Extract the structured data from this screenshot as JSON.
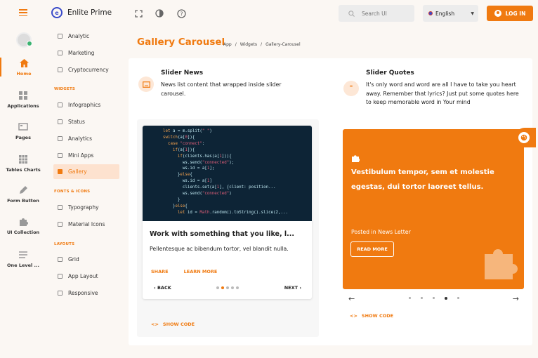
{
  "brand": {
    "name": "Enlite Prime"
  },
  "topbar": {
    "search_placeholder": "Search UI",
    "language": "English",
    "login_label": "LOG IN"
  },
  "rail": {
    "items": [
      {
        "label": "Home",
        "icon": "home-icon",
        "active": true
      },
      {
        "label": "Applications",
        "icon": "apps-icon"
      },
      {
        "label": "Pages",
        "icon": "pages-icon"
      },
      {
        "label": "Tables Charts",
        "icon": "table-icon"
      },
      {
        "label": "Form Button",
        "icon": "pen-icon"
      },
      {
        "label": "UI Collection",
        "icon": "puzzle-icon"
      },
      {
        "label": "One Level ...",
        "icon": "list-icon"
      }
    ]
  },
  "subnav": {
    "top_items": [
      "Analytic",
      "Marketing",
      "Cryptocurrency"
    ],
    "widgets_head": "WIDGETS",
    "widgets_items": [
      "Infographics",
      "Status",
      "Analytics",
      "Mini Apps",
      "Gallery"
    ],
    "fonts_head": "FONTS & ICONS",
    "fonts_items": [
      "Typography",
      "Material Icons"
    ],
    "layouts_head": "LAYOUTS",
    "layouts_items": [
      "Grid",
      "App Layout",
      "Responsive"
    ],
    "active": "Gallery"
  },
  "page": {
    "title": "Gallery Carousel",
    "breadcrumb": [
      "App",
      "/",
      "Widgets",
      "/",
      "Gallery-Carousel"
    ]
  },
  "slider_news": {
    "title": "Slider News",
    "description": "News list content that wrapped inside slider carousel.",
    "card_title": "Work with something that you like, l...",
    "card_body": "Pellentesque ac bibendum tortor, vel blandit nulla.",
    "share_label": "SHARE",
    "learn_more_label": "LEARN MORE",
    "back_label": "BACK",
    "next_label": "NEXT",
    "slide_count": 5,
    "active_slide": 1,
    "show_code": "SHOW CODE"
  },
  "slider_quotes": {
    "title": "Slider Quotes",
    "description": "It's only word and word are all I have to take you heart away. Remember that lyrics? Just put some quotes here to keep memorable word in Your mind",
    "quote": "Vestibulum tempor, sem et molestie egestas, dui tortor laoreet tellus.",
    "posted": "Posted in News Letter",
    "read_more": "READ MORE",
    "slide_count": 5,
    "active_slide": 3,
    "show_code": "SHOW CODE"
  },
  "colors": {
    "accent": "#f07a10",
    "accent_light": "#fde2cf",
    "background": "#fbf7f3"
  }
}
